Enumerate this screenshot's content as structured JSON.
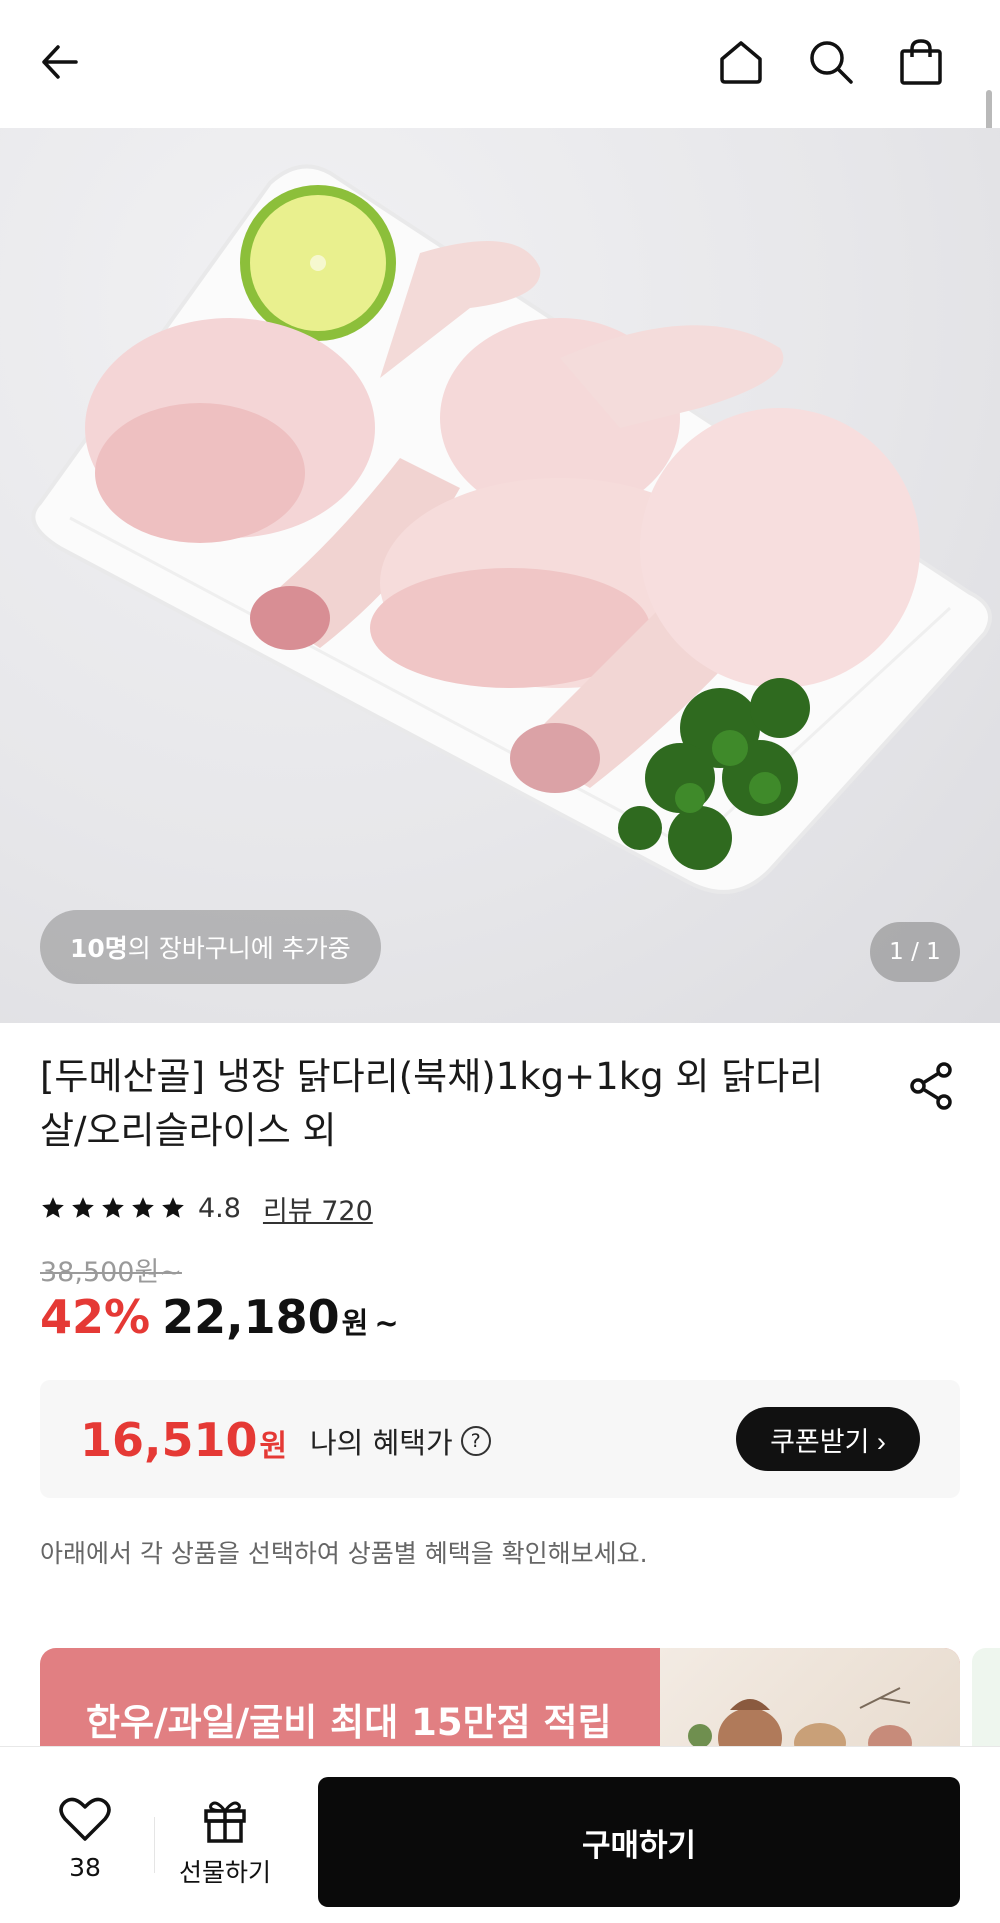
{
  "header": {
    "back_icon": "arrow-left-icon",
    "home_icon": "home-icon",
    "search_icon": "search-icon",
    "cart_icon": "shopping-bag-icon"
  },
  "hero": {
    "cart_count": "10명",
    "cart_suffix": "의 장바구니에 추가중",
    "pager": "1 / 1"
  },
  "product": {
    "title": "[두메산골] 냉장 닭다리(북채)1kg+1kg 외 닭다리살/오리슬라이스 외",
    "rating_stars": 5,
    "rating": "4.8",
    "reviews": "리뷰 720",
    "original_price": "38,500원~",
    "discount": "42%",
    "price": "22,180",
    "price_unit": "원",
    "price_tilde": "~"
  },
  "benefit": {
    "price": "16,510",
    "unit": "원",
    "label": "나의 혜택가",
    "help": "?",
    "coupon_button": "쿠폰받기 ›"
  },
  "note": "아래에서 각 상품을 선택하여 상품별 혜택을 확인해보세요.",
  "banner": {
    "text": "한우/과일/굴비 최대 15만점 적립",
    "bg_color": "#e17f82"
  },
  "bottom": {
    "like_count": "38",
    "gift_label": "선물하기",
    "buy_label": "구매하기"
  },
  "colors": {
    "accent_red": "#e53935",
    "button_black": "#0a0a0a"
  }
}
